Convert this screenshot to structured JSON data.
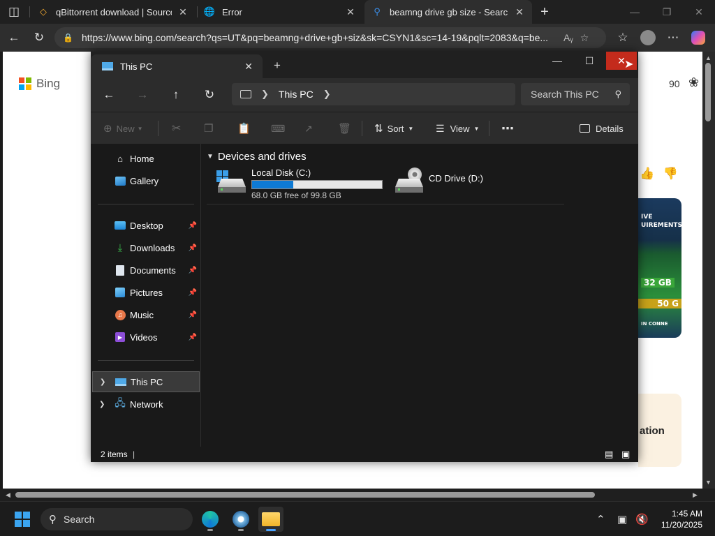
{
  "browser": {
    "tabs": [
      {
        "title": "qBittorrent download | SourceFor",
        "favicon": "qbittorrent-icon"
      },
      {
        "title": "Error",
        "favicon": "globe-icon"
      },
      {
        "title": "beamng drive gb size - Search",
        "favicon": "search-icon",
        "active": true
      }
    ],
    "url": "https://www.bing.com/search?qs=UT&pq=beamng+drive+gb+siz&sk=CSYN1&sc=14-19&pqlt=2083&q=be..."
  },
  "page": {
    "logo_text": "Bing",
    "rewards_points": "90",
    "ad_lines": [
      "IVE",
      "UIREMENTS",
      "32 GB",
      "50 G",
      "IN CONNE"
    ],
    "ad_card_text": "ation"
  },
  "explorer": {
    "tab_title": "This PC",
    "breadcrumb": "This PC",
    "search_placeholder": "Search This PC",
    "toolbar": {
      "new_label": "New",
      "sort_label": "Sort",
      "view_label": "View",
      "details_label": "Details"
    },
    "sidebar": {
      "top": [
        {
          "label": "Home",
          "icon": "home-icon"
        },
        {
          "label": "Gallery",
          "icon": "gallery-icon"
        }
      ],
      "pinned": [
        {
          "label": "Desktop",
          "icon": "desktop-folder-icon"
        },
        {
          "label": "Downloads",
          "icon": "downloads-icon"
        },
        {
          "label": "Documents",
          "icon": "documents-icon"
        },
        {
          "label": "Pictures",
          "icon": "pictures-icon"
        },
        {
          "label": "Music",
          "icon": "music-icon"
        },
        {
          "label": "Videos",
          "icon": "videos-icon"
        }
      ],
      "tree": [
        {
          "label": "This PC",
          "icon": "this-pc-icon",
          "selected": true
        },
        {
          "label": "Network",
          "icon": "network-icon"
        }
      ]
    },
    "group_title": "Devices and drives",
    "drives": [
      {
        "name": "Local Disk (C:)",
        "free_text": "68.0 GB free of 99.8 GB",
        "used_fraction": 0.319
      },
      {
        "name": "CD Drive (D:)"
      }
    ],
    "status_text": "2 items"
  },
  "taskbar": {
    "search_label": "Search",
    "time": "1:45 AM",
    "date": "11/20/2025"
  }
}
